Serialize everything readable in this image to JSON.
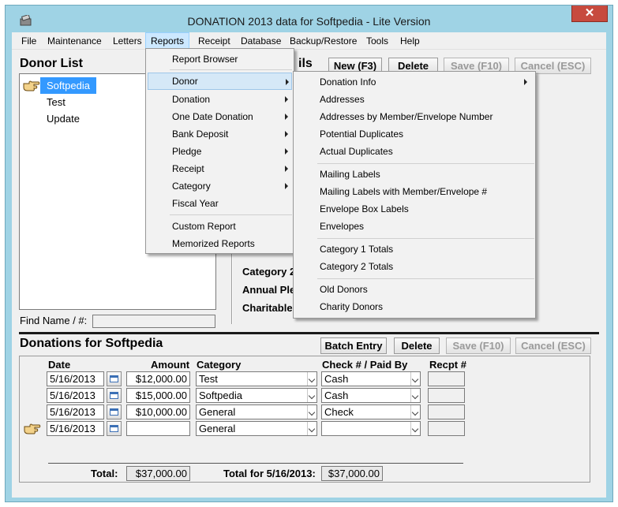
{
  "window": {
    "title": "DONATION 2013 data for Softpedia - Lite Version",
    "close_glyph": "✕"
  },
  "menubar": [
    "File",
    "Maintenance",
    "Letters",
    "Reports",
    "Receipt",
    "Database",
    "Backup/Restore",
    "Tools",
    "Help"
  ],
  "donor_list": {
    "title": "Donor List",
    "items": [
      "Softpedia",
      "Test",
      "Update"
    ],
    "find_label": "Find Name / #:"
  },
  "details": {
    "title_fragment": "ils",
    "new_label": "New (F3)",
    "delete_label": "Delete",
    "save_label": "Save (F10)",
    "cancel_label": "Cancel (ESC)",
    "category2_label": "Category 2:",
    "annual_label": "Annual Plec",
    "charitable_label": "Charitable"
  },
  "donations": {
    "title": "Donations for Softpedia",
    "batch_label": "Batch Entry",
    "delete_label": "Delete",
    "save_label": "Save (F10)",
    "cancel_label": "Cancel (ESC)",
    "headers": {
      "date": "Date",
      "amount": "Amount",
      "category": "Category",
      "check": "Check # / Paid By",
      "receipt": "Recpt #"
    },
    "rows": [
      {
        "date": "5/16/2013",
        "amount": "$12,000.00",
        "category": "Test",
        "paid_by": "Cash"
      },
      {
        "date": "5/16/2013",
        "amount": "$15,000.00",
        "category": "Softpedia",
        "paid_by": "Cash"
      },
      {
        "date": "5/16/2013",
        "amount": "$10,000.00",
        "category": "General",
        "paid_by": "Check"
      },
      {
        "date": "5/16/2013",
        "amount": "",
        "category": "General",
        "paid_by": ""
      }
    ],
    "total_label": "Total:",
    "total_value": "$37,000.00",
    "total_date_label": "Total for 5/16/2013:",
    "total_date_value": "$37,000.00"
  },
  "reports_menu": {
    "items": [
      "Report Browser",
      "Donor",
      "Donation",
      "One Date Donation",
      "Bank Deposit",
      "Pledge",
      "Receipt",
      "Category",
      "Fiscal Year",
      "Custom Report",
      "Memorized Reports"
    ]
  },
  "donor_submenu": {
    "items": [
      "Donation Info",
      "Addresses",
      "Addresses by Member/Envelope Number",
      "Potential Duplicates",
      "Actual Duplicates",
      "Mailing Labels",
      "Mailing Labels with Member/Envelope #",
      "Envelope Box Labels",
      "Envelopes",
      "Category 1 Totals",
      "Category 2 Totals",
      "Old Donors",
      "Charity Donors"
    ]
  },
  "icons": {
    "app": "donation-app-icon",
    "hand": "pointing-hand-icon",
    "calendar": "calendar-icon",
    "dropdown": "chevron-down-icon",
    "submenu": "chevron-right-icon"
  },
  "colors": {
    "titlebar": "#9fd3e5",
    "close": "#c74a3e",
    "selection": "#3399ff",
    "menu_highlight": "#cce8ff"
  }
}
